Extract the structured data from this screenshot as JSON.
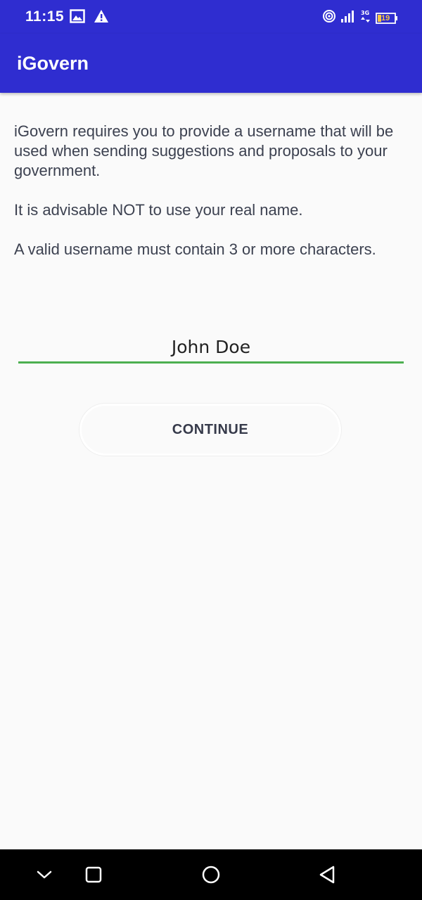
{
  "status_bar": {
    "time": "11:15",
    "icons": [
      "image-icon",
      "warning-icon",
      "hotspot-icon",
      "signal-icon",
      "network-3g-icon",
      "battery-icon"
    ],
    "battery_level": "19"
  },
  "app_bar": {
    "title": "iGovern"
  },
  "content": {
    "paragraph1": "iGovern requires you to provide a username that will be used when sending suggestions and proposals to your government.",
    "paragraph2": "It is advisable NOT to use your real name.",
    "paragraph3": "A valid username must contain 3 or more characters."
  },
  "form": {
    "username_value": "John Doe",
    "continue_label": "CONTINUE"
  },
  "nav_bar": {
    "icons": [
      "chevron-down-icon",
      "recents-icon",
      "home-icon",
      "back-icon"
    ]
  },
  "colors": {
    "primary": "#2f2dd0",
    "input_underline": "#4caf50",
    "background": "#fafafa",
    "text": "#3c4150"
  }
}
